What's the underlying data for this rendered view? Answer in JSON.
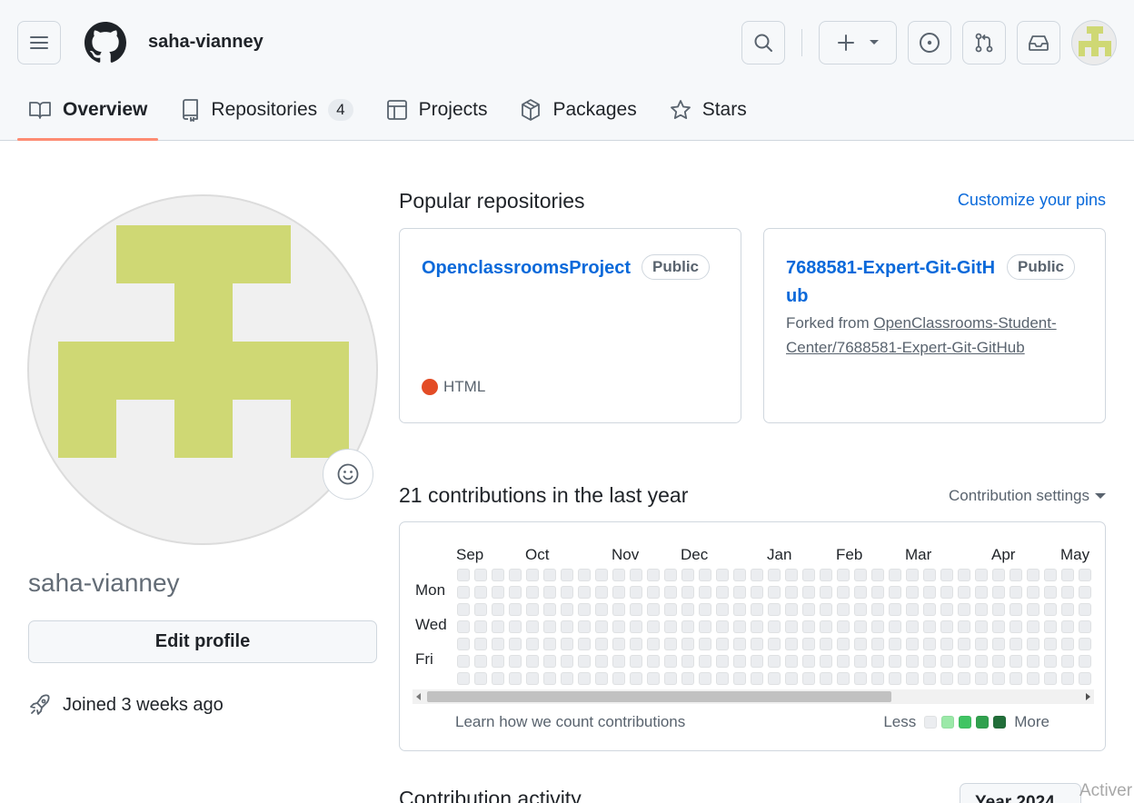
{
  "header": {
    "username": "saha-vianney"
  },
  "tabs": [
    {
      "label": "Overview",
      "icon": "book-icon"
    },
    {
      "label": "Repositories",
      "icon": "repo-icon",
      "count": "4"
    },
    {
      "label": "Projects",
      "icon": "table-icon"
    },
    {
      "label": "Packages",
      "icon": "package-icon"
    },
    {
      "label": "Stars",
      "icon": "star-icon"
    }
  ],
  "profile": {
    "name": "saha-vianney",
    "edit_label": "Edit profile",
    "joined": "Joined 3 weeks ago",
    "avatar_color": "#cfd874"
  },
  "popular": {
    "title": "Popular repositories",
    "customize": "Customize your pins",
    "repos": [
      {
        "name": "OpenclassroomsProject",
        "visibility": "Public",
        "language": "HTML",
        "language_color": "#e34c26"
      },
      {
        "name": "7688581-Expert-Git-GitHub",
        "visibility": "Public",
        "forked_prefix": "Forked from ",
        "forked_from": "OpenClassrooms-Student-Center/7688581-Expert-Git-GitHub"
      }
    ]
  },
  "contributions": {
    "title": "21 contributions in the last year",
    "settings": "Contribution settings",
    "months": [
      "Sep",
      "Oct",
      "Nov",
      "Dec",
      "Jan",
      "Feb",
      "Mar",
      "Apr",
      "May"
    ],
    "days": [
      "Mon",
      "Wed",
      "Fri"
    ],
    "learn": "Learn how we count contributions",
    "less": "Less",
    "more": "More",
    "legend_colors": [
      "#ebedf0",
      "#9be9a8",
      "#40c463",
      "#30a14e",
      "#216e39"
    ]
  },
  "activity": {
    "title": "Contribution activity",
    "year": "Year 2024"
  },
  "watermark": "Activer"
}
